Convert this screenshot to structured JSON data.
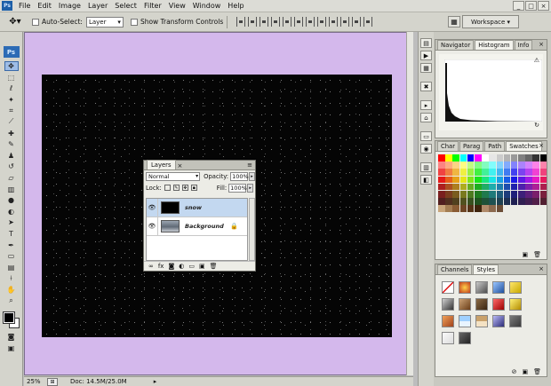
{
  "app": {
    "logo_label": "Ps",
    "menu": [
      "File",
      "Edit",
      "Image",
      "Layer",
      "Select",
      "Filter",
      "View",
      "Window",
      "Help"
    ],
    "window_buttons": [
      "_",
      "□",
      "×"
    ]
  },
  "options": {
    "auto_select_label": "Auto-Select:",
    "auto_select_value": "Layer",
    "show_transform_label": "Show Transform Controls",
    "workspace_label": "Workspace ▾"
  },
  "status": {
    "zoom": "25%",
    "doc_size": "Doc: 14.5M/25.0M",
    "arrow": "▸"
  },
  "panels": {
    "navigator_tabs": [
      "Navigator",
      "Histogram",
      "Info"
    ],
    "navigator_close": "×",
    "swatch_tabs": [
      "Char",
      "Parag",
      "Path",
      "Swatches"
    ],
    "swatch_close": "×",
    "styles_tabs": [
      "Channels",
      "Styles"
    ],
    "styles_close": "×",
    "menu_glyph": "≡",
    "footer_new": "▣",
    "footer_delete": "🗑"
  },
  "layers": {
    "title": "Layers",
    "close": "×",
    "blend_mode": "Normal",
    "opacity_label": "Opacity:",
    "opacity_value": "100%",
    "lock_label": "Lock:",
    "fill_label": "Fill:",
    "fill_value": "100%",
    "items": [
      {
        "name": "snow",
        "selected": true
      },
      {
        "name": "Background",
        "selected": false,
        "locked": true
      }
    ],
    "eye_glyph": "👁",
    "lock_glyph": "🔒"
  },
  "colors": {
    "document_background": "#d4b8ec",
    "canvas": "#050505",
    "foreground": "#000000",
    "background": "#ffffff",
    "selection": "#c3d8f0"
  }
}
